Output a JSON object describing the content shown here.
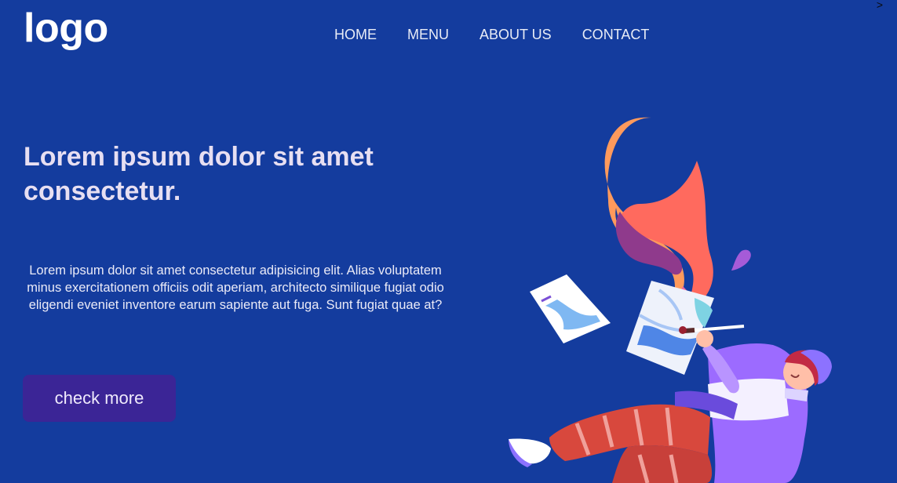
{
  "corner_mark": ">",
  "header": {
    "logo": "logo",
    "nav": [
      {
        "label": "HOME"
      },
      {
        "label": "MENU"
      },
      {
        "label": "ABOUT US"
      },
      {
        "label": "CONTACT"
      }
    ]
  },
  "hero": {
    "headline": "Lorem ipsum dolor sit amet consectetur.",
    "body": "Lorem ipsum dolor sit amet consectetur adipisicing elit. Alias voluptatem minus exercitationem officiis odit aperiam, architecto similique fugiat odio eligendi eveniet inventore earum sapiente aut fuga. Sunt fugiat quae at?",
    "cta_label": "check more",
    "illustration": "floating-painter-illustration"
  },
  "colors": {
    "background": "#143c9e",
    "button": "#3b2596",
    "headline": "#e7dff2"
  }
}
